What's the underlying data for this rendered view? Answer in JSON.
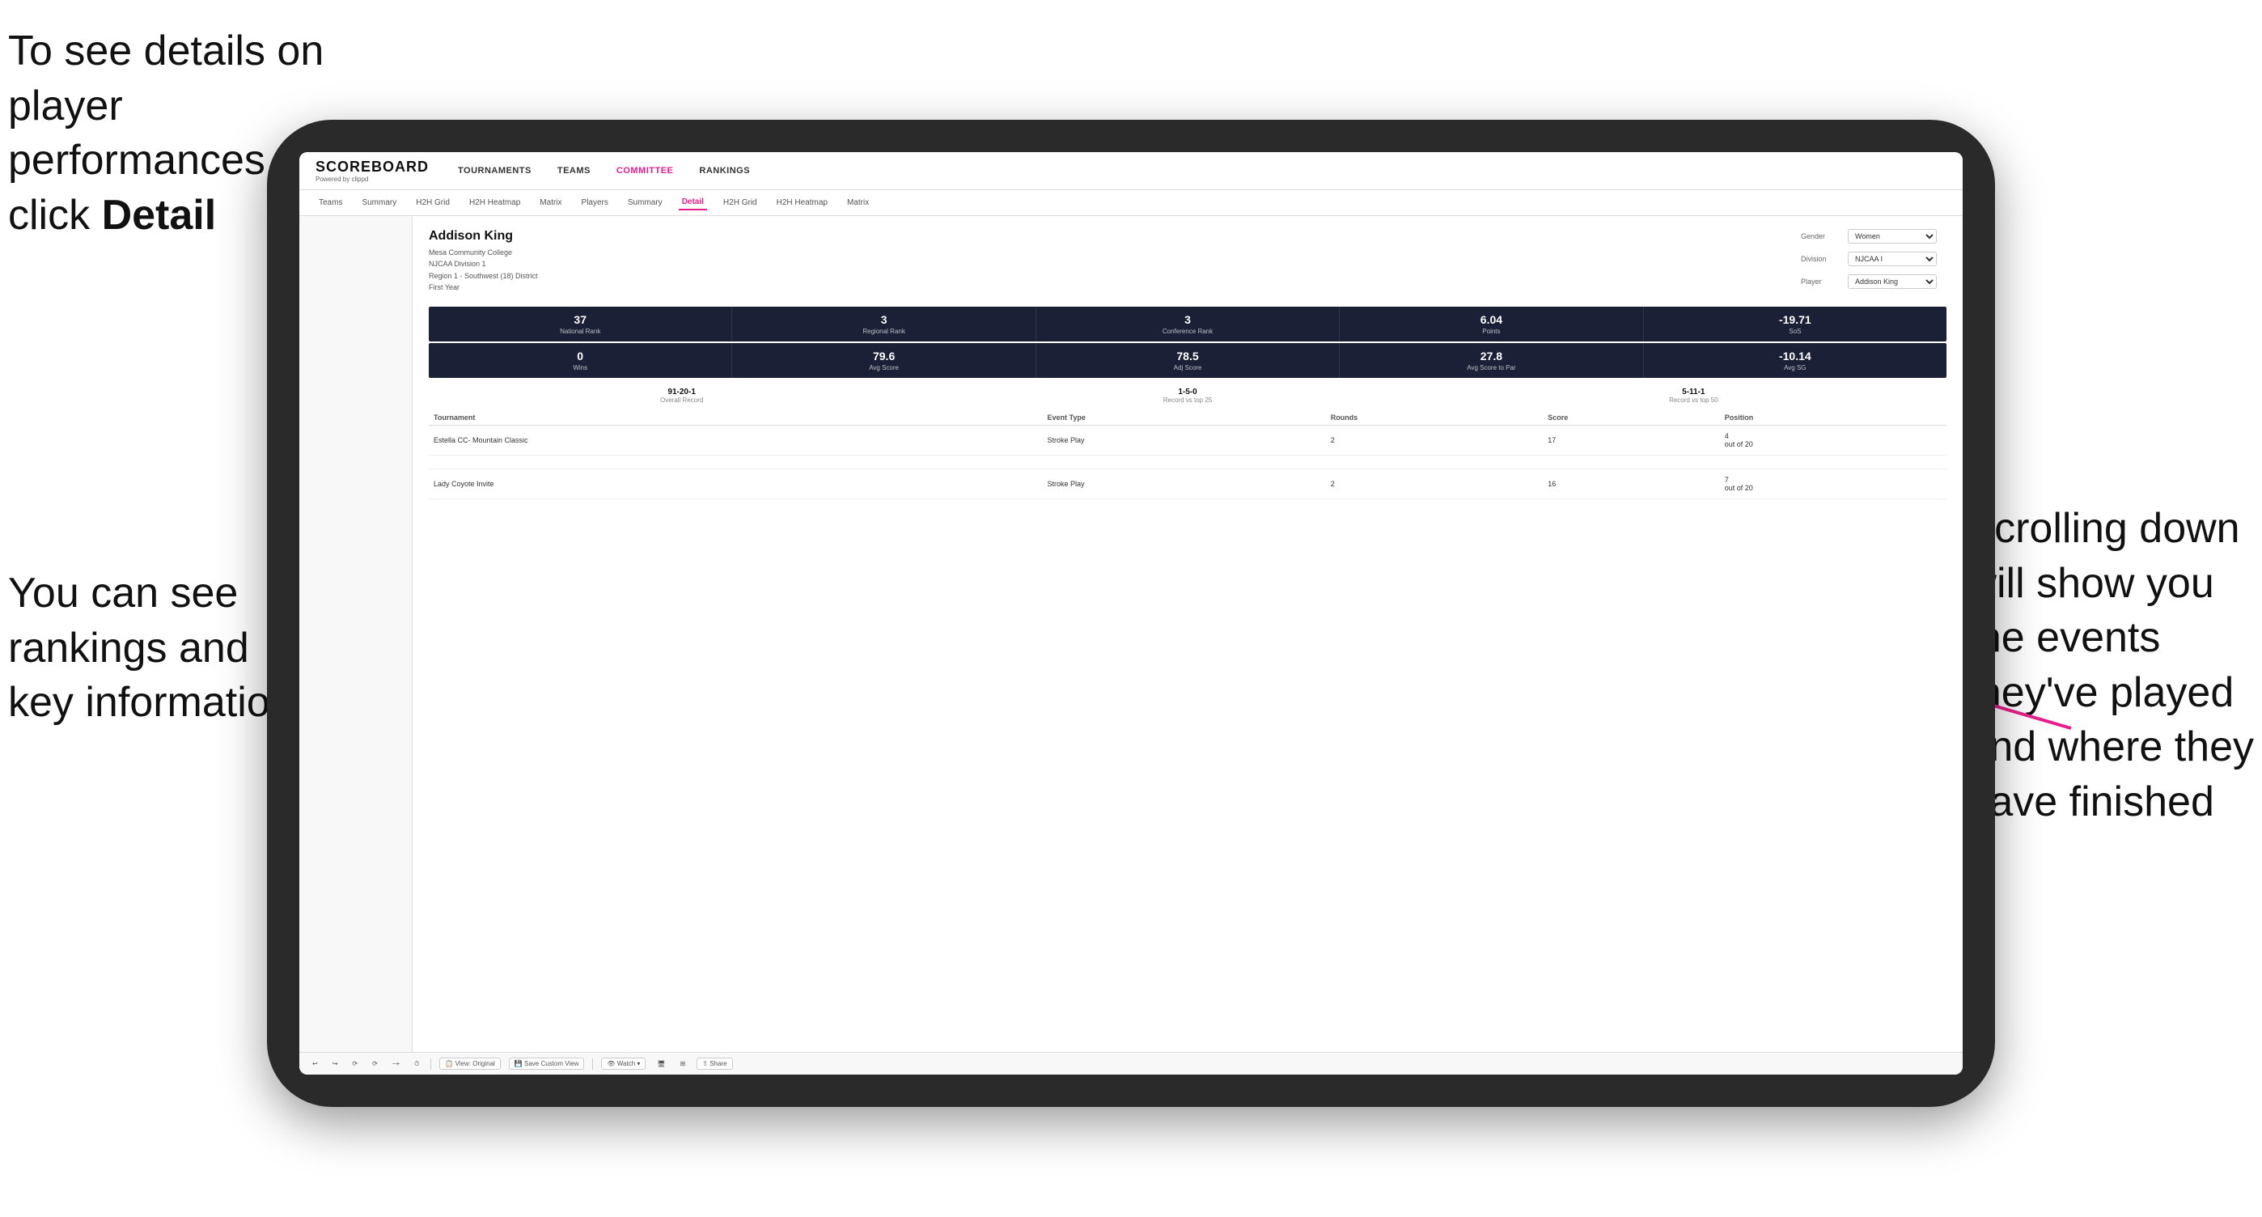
{
  "annotations": {
    "topleft_line1": "To see details on",
    "topleft_line2": "player performances",
    "topleft_line3": "click ",
    "topleft_bold": "Detail",
    "bottomleft_line1": "You can see",
    "bottomleft_line2": "rankings and",
    "bottomleft_line3": "key information",
    "right_line1": "Scrolling down",
    "right_line2": "will show you",
    "right_line3": "the events",
    "right_line4": "they've played",
    "right_line5": "and where they",
    "right_line6": "have finished"
  },
  "app": {
    "logo": "SCOREBOARD",
    "logo_sub": "Powered by clippd",
    "nav_items": [
      "TOURNAMENTS",
      "TEAMS",
      "COMMITTEE",
      "RANKINGS"
    ],
    "sub_nav_items": [
      "Teams",
      "Summary",
      "H2H Grid",
      "H2H Heatmap",
      "Matrix",
      "Players",
      "Summary",
      "Detail",
      "H2H Grid",
      "H2H Heatmap",
      "Matrix"
    ],
    "active_sub_nav": "Detail"
  },
  "player": {
    "name": "Addison King",
    "college": "Mesa Community College",
    "division": "NJCAA Division 1",
    "region": "Region 1 - Southwest (18) District",
    "year": "First Year",
    "gender_label": "Gender",
    "gender_value": "Women",
    "division_label": "Division",
    "division_value": "NJCAA I",
    "player_label": "Player",
    "player_value": "Addison King"
  },
  "stats_row1": [
    {
      "value": "37",
      "label": "National Rank"
    },
    {
      "value": "3",
      "label": "Regional Rank"
    },
    {
      "value": "3",
      "label": "Conference Rank"
    },
    {
      "value": "6.04",
      "label": "Points"
    },
    {
      "value": "-19.71",
      "label": "SoS"
    }
  ],
  "stats_row2": [
    {
      "value": "0",
      "label": "Wins"
    },
    {
      "value": "79.6",
      "label": "Avg Score"
    },
    {
      "value": "78.5",
      "label": "Adj Score"
    },
    {
      "value": "27.8",
      "label": "Avg Score to Par"
    },
    {
      "value": "-10.14",
      "label": "Avg SG"
    }
  ],
  "records": [
    {
      "value": "91-20-1",
      "label": "Overall Record"
    },
    {
      "value": "1-5-0",
      "label": "Record vs top 25"
    },
    {
      "value": "5-11-1",
      "label": "Record vs top 50"
    }
  ],
  "table_headers": [
    "Tournament",
    "Event Type",
    "Rounds",
    "Score",
    "Position"
  ],
  "table_rows": [
    {
      "tournament": "Estella CC- Mountain Classic",
      "event_type": "Stroke Play",
      "rounds": "2",
      "score": "17",
      "position": "4\nout of 20"
    },
    {
      "tournament": "Lady Coyote Invite",
      "event_type": "Stroke Play",
      "rounds": "2",
      "score": "16",
      "position": "7\nout of 20"
    }
  ],
  "toolbar": {
    "items": [
      "↩",
      "↪",
      "⟳",
      "⟳",
      "−+",
      "⏱",
      "View: Original",
      "Save Custom View",
      "👁 Watch ▾",
      "🖥",
      "⊞",
      "Share"
    ]
  }
}
